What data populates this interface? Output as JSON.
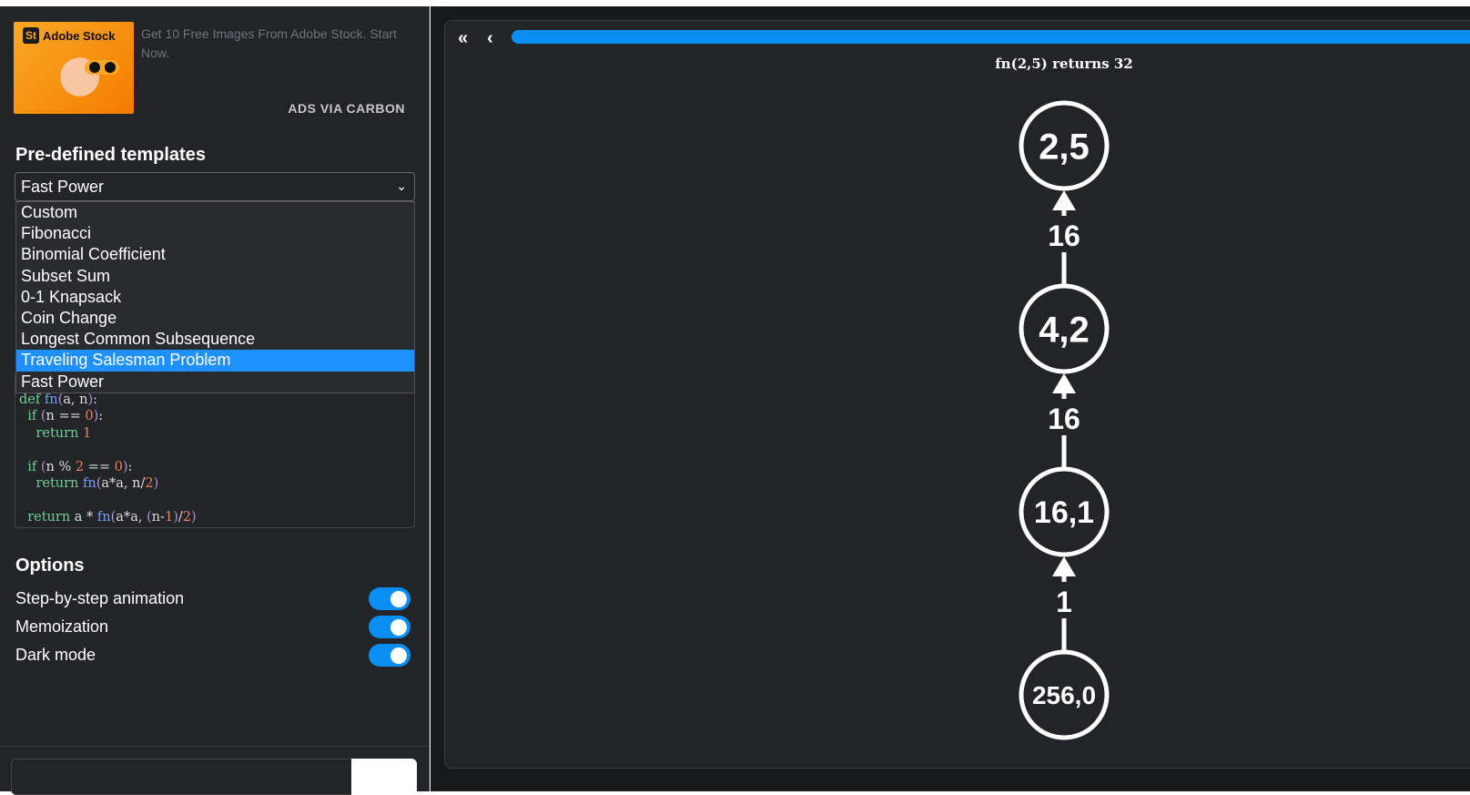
{
  "ad": {
    "brand": "Adobe Stock",
    "logo_mark": "St",
    "text": "Get 10 Free Images From Adobe Stock. Start Now.",
    "via": "ADS VIA CARBON"
  },
  "templates": {
    "heading": "Pre-defined templates",
    "selected": "Fast Power",
    "options": [
      "Custom",
      "Fibonacci",
      "Binomial Coefficient",
      "Subset Sum",
      "0-1 Knapsack",
      "Coin Change",
      "Longest Common Subsequence",
      "Traveling Salesman Problem",
      "Fast Power"
    ],
    "highlighted": "Traveling Salesman Problem"
  },
  "code": [
    "def fn(a, n):",
    "  if (n == 0):",
    "    return 1",
    "",
    "  if (n % 2 == 0):",
    "    return fn(a*a, n/2)",
    "",
    "  return a * fn(a*a, (n-1)/2)"
  ],
  "options": {
    "heading": "Options",
    "items": [
      {
        "label": "Step-by-step animation",
        "on": true
      },
      {
        "label": "Memoization",
        "on": true
      },
      {
        "label": "Dark mode",
        "on": true
      }
    ]
  },
  "viewer": {
    "first_icon": "double-chevron-left-icon",
    "prev_icon": "chevron-left-icon",
    "progress_percent": 100,
    "result": "fn(2,5) returns 32",
    "nodes": [
      "2,5",
      "4,2",
      "16,1",
      "256,0"
    ],
    "edges": [
      "16",
      "16",
      "1"
    ]
  },
  "colors": {
    "accent": "#0a8ef4",
    "bg": "#232427"
  }
}
